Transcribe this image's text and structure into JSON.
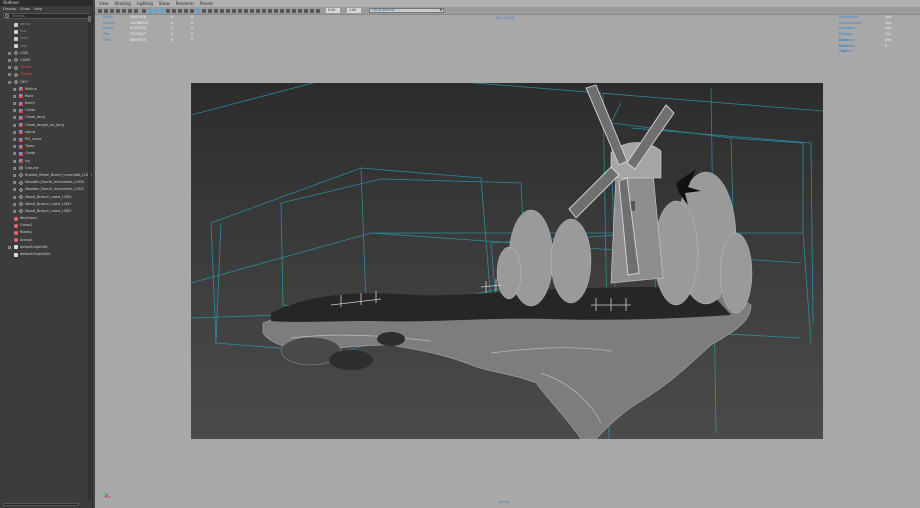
{
  "outliner": {
    "title": "Outliner",
    "menu": [
      "Display",
      "Show",
      "Help"
    ],
    "search_placeholder": "Search...",
    "items": [
      {
        "label": "persp",
        "type": "cam",
        "expander": false,
        "dim": true
      },
      {
        "label": "top",
        "type": "cam",
        "expander": false,
        "dim": true
      },
      {
        "label": "front",
        "type": "cam",
        "expander": false,
        "dim": true
      },
      {
        "label": "side",
        "type": "cam",
        "expander": false,
        "dim": true
      },
      {
        "label": "LGTs",
        "type": "grp",
        "expander": true
      },
      {
        "label": "CAMS",
        "type": "grp",
        "expander": true
      },
      {
        "label": "Ocean",
        "type": "grp",
        "expander": true,
        "red": true
      },
      {
        "label": "Clouds",
        "type": "grp",
        "expander": true,
        "red": true
      },
      {
        "label": "GEO",
        "type": "grp",
        "expander": true
      },
      {
        "label": "Molino",
        "type": "mesh",
        "expander": true,
        "indent": 1
      },
      {
        "label": "Rock",
        "type": "mesh",
        "expander": true,
        "indent": 1
      },
      {
        "label": "Barril",
        "type": "mesh",
        "expander": true,
        "indent": 1
      },
      {
        "label": "Cesto",
        "type": "mesh",
        "expander": true,
        "indent": 1
      },
      {
        "label": "Cesto_long",
        "type": "mesh",
        "expander": true,
        "indent": 1
      },
      {
        "label": "Cesto_longer_as_long",
        "type": "mesh",
        "expander": true,
        "indent": 1
      },
      {
        "label": "stand",
        "type": "mesh",
        "expander": true,
        "indent": 1
      },
      {
        "label": "Pill_rocks",
        "type": "mesh",
        "expander": true,
        "indent": 1
      },
      {
        "label": "Trees",
        "type": "mesh",
        "expander": true,
        "indent": 1
      },
      {
        "label": "Cesto",
        "type": "mesh",
        "expander": true,
        "indent": 1
      },
      {
        "label": "lvy",
        "type": "mesh",
        "expander": true,
        "indent": 1
      },
      {
        "label": "Ground",
        "type": "grp",
        "expander": true,
        "indent": 1
      },
      {
        "label": "Rusted_Metal_Barrel_Innerhalb_LOD0",
        "type": "grp",
        "expander": true,
        "indent": 1
      },
      {
        "label": "Wooden_Barrel_Innenseite_LOD0",
        "type": "grp",
        "expander": true,
        "indent": 1
      },
      {
        "label": "Wooden_Barrel_Innenseite_LOD1",
        "type": "grp",
        "expander": true,
        "indent": 1
      },
      {
        "label": "Wood_Branch_rowe_LOD0",
        "type": "grp",
        "expander": true,
        "indent": 1
      },
      {
        "label": "Wood_Branch_rowe_LOD1",
        "type": "grp",
        "expander": true,
        "indent": 1
      },
      {
        "label": "Wood_Branch_rowe_LOD2",
        "type": "grp",
        "expander": true,
        "indent": 1
      },
      {
        "label": "Keylines1",
        "type": "light",
        "expander": false
      },
      {
        "label": "Grass2",
        "type": "light",
        "expander": false
      },
      {
        "label": "Roots1",
        "type": "light",
        "expander": false
      },
      {
        "label": "Arrow1",
        "type": "light",
        "expander": false
      },
      {
        "label": "defaultLightSet",
        "type": "set",
        "expander": true
      },
      {
        "label": "defaultObjectSet",
        "type": "set",
        "expander": false
      }
    ]
  },
  "viewport": {
    "menu": [
      "View",
      "Shading",
      "Lighting",
      "Show",
      "Renderer",
      "Panels"
    ],
    "toolbar": {
      "exposure": "0.00",
      "gamma": "1.00",
      "colorspace": "sRGB gamma",
      "colorspace_label": "sRGB gamma"
    },
    "hud_left": [
      {
        "label": "Verts:",
        "v1": "7847466",
        "v2": "0",
        "v3": "0"
      },
      {
        "label": "Edges:",
        "v1": "16788630",
        "v2": "0",
        "v3": "0"
      },
      {
        "label": "Faces:",
        "v1": "8287003",
        "v2": "0",
        "v3": "0"
      },
      {
        "label": "Tris:",
        "v1": "7370447",
        "v2": "0",
        "v3": "0"
      },
      {
        "label": "UVs:",
        "v1": "8603575",
        "v2": "0",
        "v3": "0"
      }
    ],
    "hud_center": "944 x 508",
    "hud_right": [
      {
        "label": "Backfaces:",
        "value": "N/A"
      },
      {
        "label": "Smoothness:",
        "value": "N/A"
      },
      {
        "label": "Instance:",
        "value": "N/A"
      },
      {
        "label": "Display Layer:",
        "value": "N/A"
      },
      {
        "label": "Distance From Cam:",
        "value": "N/A"
      },
      {
        "label": "Selected Objects:",
        "value": "0"
      }
    ],
    "camera_name": "persp"
  },
  "colors": {
    "hud_key": "#3a82c4",
    "accent": "#5aa6d6",
    "wire": "#2aa5bd"
  }
}
